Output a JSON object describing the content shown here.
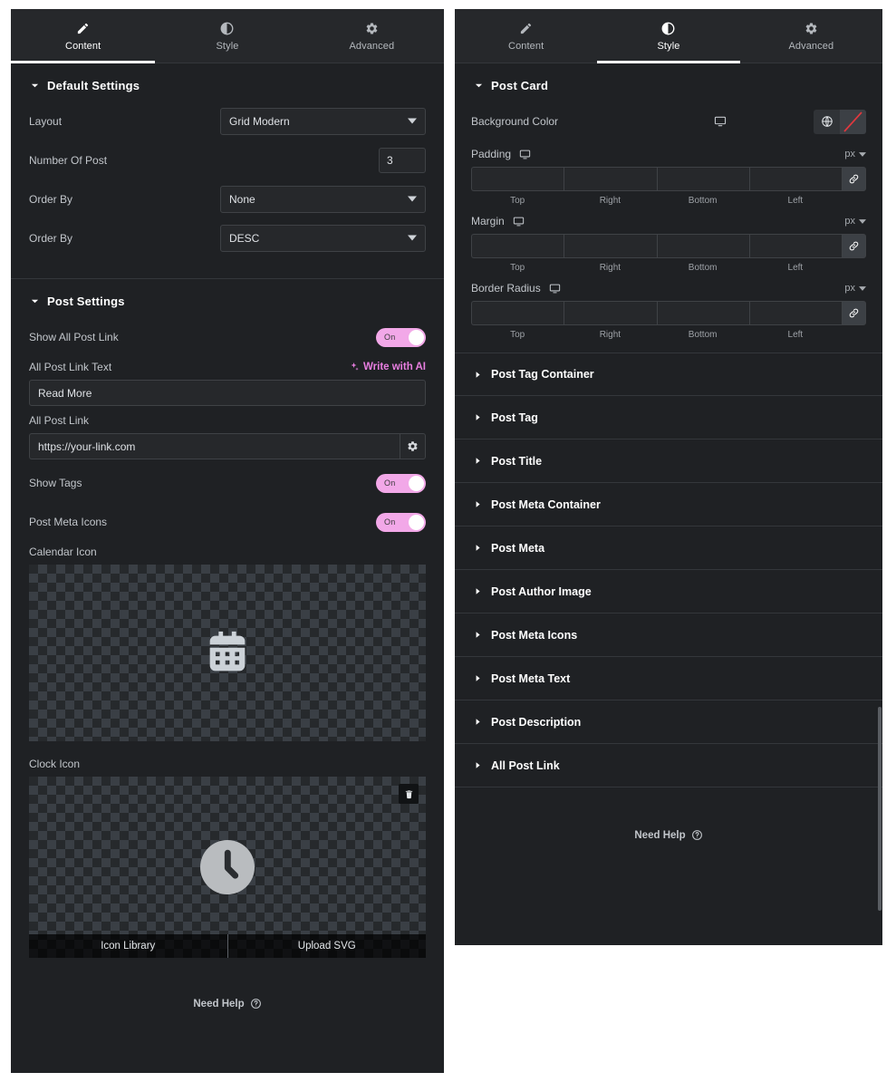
{
  "tabs": {
    "content": "Content",
    "style": "Style",
    "advanced": "Advanced"
  },
  "left_panel": {
    "active_tab": "Content",
    "default_settings": {
      "title": "Default Settings",
      "layout": {
        "label": "Layout",
        "value": "Grid Modern"
      },
      "number_of_post": {
        "label": "Number Of Post",
        "value": "3"
      },
      "order_by": {
        "label": "Order By",
        "value": "None"
      },
      "order_direction": {
        "label": "Order By",
        "value": "DESC"
      }
    },
    "post_settings": {
      "title": "Post Settings",
      "show_all_post_link": {
        "label": "Show All Post Link",
        "toggle": "On"
      },
      "all_post_link_text": {
        "label": "All Post Link Text",
        "ai_label": "Write with AI",
        "value": "Read More"
      },
      "all_post_link": {
        "label": "All Post Link",
        "value": "https://your-link.com"
      },
      "show_tags": {
        "label": "Show Tags",
        "toggle": "On"
      },
      "post_meta_icons": {
        "label": "Post Meta Icons",
        "toggle": "On"
      },
      "calendar_icon": {
        "label": "Calendar Icon"
      },
      "clock_icon": {
        "label": "Clock Icon",
        "icon_library": "Icon Library",
        "upload_svg": "Upload SVG"
      }
    },
    "need_help": "Need Help"
  },
  "right_panel": {
    "active_tab": "Style",
    "post_card": {
      "title": "Post Card",
      "background_color": {
        "label": "Background Color"
      },
      "padding": {
        "label": "Padding",
        "unit": "px",
        "sides": [
          "Top",
          "Right",
          "Bottom",
          "Left"
        ],
        "values": [
          "",
          "",
          "",
          ""
        ]
      },
      "margin": {
        "label": "Margin",
        "unit": "px",
        "sides": [
          "Top",
          "Right",
          "Bottom",
          "Left"
        ],
        "values": [
          "",
          "",
          "",
          ""
        ]
      },
      "border_radius": {
        "label": "Border Radius",
        "unit": "px",
        "sides": [
          "Top",
          "Right",
          "Bottom",
          "Left"
        ],
        "values": [
          "",
          "",
          "",
          ""
        ]
      }
    },
    "sections": [
      {
        "title": "Post Tag Container"
      },
      {
        "title": "Post Tag"
      },
      {
        "title": "Post Title"
      },
      {
        "title": "Post Meta Container"
      },
      {
        "title": "Post Meta"
      },
      {
        "title": "Post Author Image"
      },
      {
        "title": "Post Meta Icons"
      },
      {
        "title": "Post Meta Text"
      },
      {
        "title": "Post Description"
      },
      {
        "title": "All Post Link"
      }
    ],
    "need_help": "Need Help"
  },
  "colors": {
    "panel_bg": "#1f2124",
    "tabbar_bg": "#26282b",
    "toggle_on": "#f2a8e8",
    "ai_accent": "#e87ee0",
    "swatch_slash": "#e0383e",
    "text_primary": "#ffffff",
    "text_secondary": "#c2c6cb"
  }
}
